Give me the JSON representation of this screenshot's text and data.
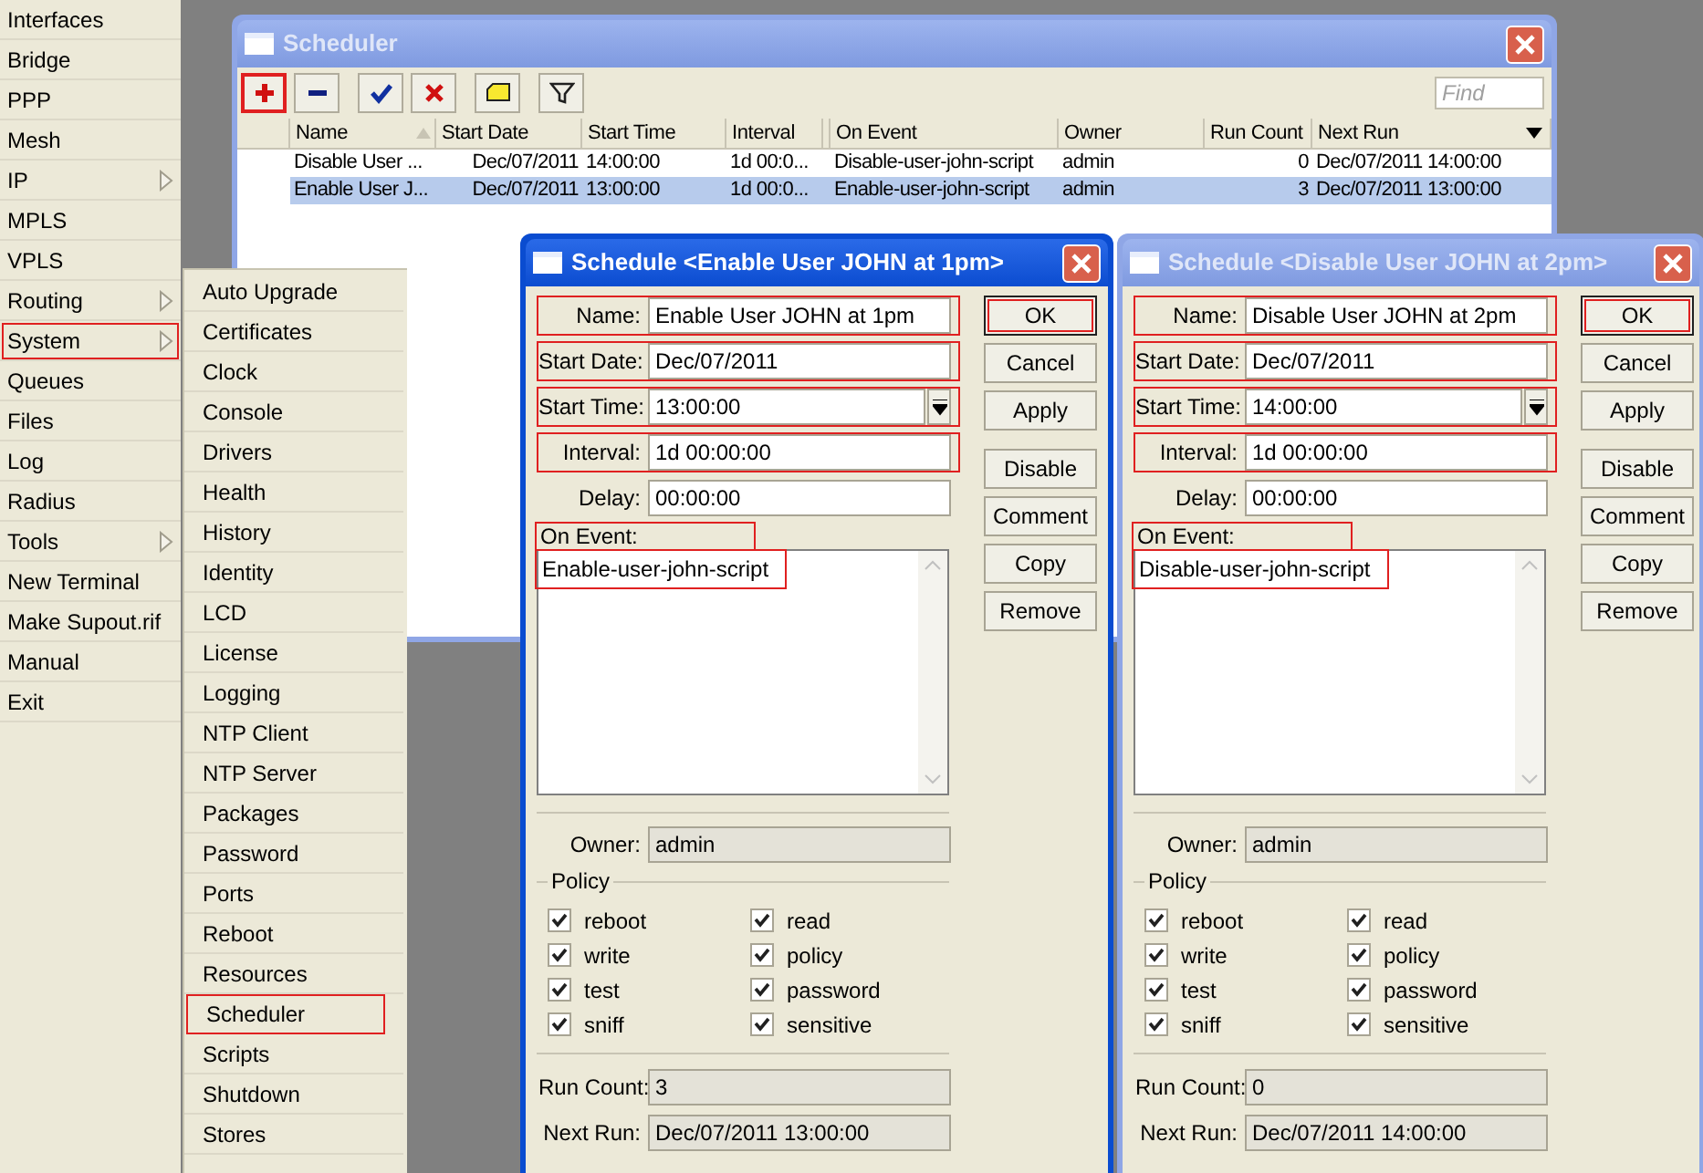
{
  "main_menu": {
    "items": [
      {
        "label": "Interfaces",
        "has_submenu": false,
        "highlighted": false
      },
      {
        "label": "Bridge",
        "has_submenu": false,
        "highlighted": false
      },
      {
        "label": "PPP",
        "has_submenu": false,
        "highlighted": false
      },
      {
        "label": "Mesh",
        "has_submenu": false,
        "highlighted": false
      },
      {
        "label": "IP",
        "has_submenu": true,
        "highlighted": false
      },
      {
        "label": "MPLS",
        "has_submenu": false,
        "highlighted": false
      },
      {
        "label": "VPLS",
        "has_submenu": false,
        "highlighted": false
      },
      {
        "label": "Routing",
        "has_submenu": true,
        "highlighted": false
      },
      {
        "label": "System",
        "has_submenu": true,
        "highlighted": true
      },
      {
        "label": "Queues",
        "has_submenu": false,
        "highlighted": false
      },
      {
        "label": "Files",
        "has_submenu": false,
        "highlighted": false
      },
      {
        "label": "Log",
        "has_submenu": false,
        "highlighted": false
      },
      {
        "label": "Radius",
        "has_submenu": false,
        "highlighted": false
      },
      {
        "label": "Tools",
        "has_submenu": true,
        "highlighted": false
      },
      {
        "label": "New Terminal",
        "has_submenu": false,
        "highlighted": false
      },
      {
        "label": "Make Supout.rif",
        "has_submenu": false,
        "highlighted": false
      },
      {
        "label": "Manual",
        "has_submenu": false,
        "highlighted": false
      },
      {
        "label": "Exit",
        "has_submenu": false,
        "highlighted": false
      }
    ]
  },
  "submenu": {
    "items": [
      {
        "label": "Auto Upgrade",
        "highlighted": false
      },
      {
        "label": "Certificates",
        "highlighted": false
      },
      {
        "label": "Clock",
        "highlighted": false
      },
      {
        "label": "Console",
        "highlighted": false
      },
      {
        "label": "Drivers",
        "highlighted": false
      },
      {
        "label": "Health",
        "highlighted": false
      },
      {
        "label": "History",
        "highlighted": false
      },
      {
        "label": "Identity",
        "highlighted": false
      },
      {
        "label": "LCD",
        "highlighted": false
      },
      {
        "label": "License",
        "highlighted": false
      },
      {
        "label": "Logging",
        "highlighted": false
      },
      {
        "label": "NTP Client",
        "highlighted": false
      },
      {
        "label": "NTP Server",
        "highlighted": false
      },
      {
        "label": "Packages",
        "highlighted": false
      },
      {
        "label": "Password",
        "highlighted": false
      },
      {
        "label": "Ports",
        "highlighted": false
      },
      {
        "label": "Reboot",
        "highlighted": false
      },
      {
        "label": "Resources",
        "highlighted": false
      },
      {
        "label": "Scheduler",
        "highlighted": true
      },
      {
        "label": "Scripts",
        "highlighted": false
      },
      {
        "label": "Shutdown",
        "highlighted": false
      },
      {
        "label": "Stores",
        "highlighted": false
      }
    ]
  },
  "scheduler": {
    "title": "Scheduler",
    "active": false,
    "toolbar": [
      {
        "kind": "add",
        "highlighted": true
      },
      {
        "kind": "remove",
        "highlighted": false
      },
      {
        "kind": "enable",
        "highlighted": false
      },
      {
        "kind": "disable",
        "highlighted": false
      },
      {
        "kind": "comment",
        "highlighted": false
      },
      {
        "kind": "filter",
        "highlighted": false
      }
    ],
    "find_placeholder": "Find",
    "columns": [
      {
        "label": "Name",
        "sorted": true
      },
      {
        "label": "Start Date",
        "sorted": false
      },
      {
        "label": "Start Time",
        "sorted": false
      },
      {
        "label": "Interval",
        "sorted": false
      },
      {
        "label": "On Event",
        "sorted": false
      },
      {
        "label": "Owner",
        "sorted": false
      },
      {
        "label": "Run Count",
        "sorted": false
      },
      {
        "label": "Next Run",
        "sorted": false
      }
    ],
    "rows": [
      {
        "selected": false,
        "cells": [
          "Disable User ...",
          "Dec/07/2011",
          "14:00:00",
          "1d 00:0...",
          "Disable-user-john-script",
          "admin",
          "0",
          "Dec/07/2011 14:00:00"
        ]
      },
      {
        "selected": true,
        "cells": [
          "Enable User J...",
          "Dec/07/2011",
          "13:00:00",
          "1d 00:0...",
          "Enable-user-john-script",
          "admin",
          "3",
          "Dec/07/2011 13:00:00"
        ]
      }
    ]
  },
  "dialogs": [
    {
      "title": "Schedule <Enable User JOHN at 1pm>",
      "active": true,
      "fields": [
        {
          "kind": "text",
          "label": "Name:",
          "value": "Enable User JOHN at 1pm",
          "highlighted": true
        },
        {
          "kind": "text",
          "label": "Start Date:",
          "value": "Dec/07/2011",
          "highlighted": true
        },
        {
          "kind": "dropdown",
          "label": "Start Time:",
          "value": "13:00:00",
          "highlighted": true
        },
        {
          "kind": "text",
          "label": "Interval:",
          "value": "1d 00:00:00",
          "highlighted": true
        },
        {
          "kind": "text",
          "label": "Delay:",
          "value": "00:00:00",
          "highlighted": false
        }
      ],
      "on_event": {
        "label": "On Event:",
        "value": "Enable-user-john-script",
        "highlighted": true
      },
      "owner": {
        "label": "Owner:",
        "value": "admin"
      },
      "policy": {
        "label": "Policy",
        "options": [
          {
            "label": "reboot",
            "checked": true
          },
          {
            "label": "read",
            "checked": true
          },
          {
            "label": "write",
            "checked": true
          },
          {
            "label": "policy",
            "checked": true
          },
          {
            "label": "test",
            "checked": true
          },
          {
            "label": "password",
            "checked": true
          },
          {
            "label": "sniff",
            "checked": true
          },
          {
            "label": "sensitive",
            "checked": true
          }
        ]
      },
      "run_count": {
        "label": "Run Count:",
        "value": "3"
      },
      "next_run": {
        "label": "Next Run:",
        "value": "Dec/07/2011 13:00:00"
      },
      "buttons": [
        {
          "label": "OK",
          "highlighted": true
        },
        {
          "label": "Cancel",
          "highlighted": false
        },
        {
          "label": "Apply",
          "highlighted": false
        },
        {
          "label": "Disable",
          "highlighted": false
        },
        {
          "label": "Comment",
          "highlighted": false
        },
        {
          "label": "Copy",
          "highlighted": false
        },
        {
          "label": "Remove",
          "highlighted": false
        }
      ]
    },
    {
      "title": "Schedule <Disable User JOHN at 2pm>",
      "active": false,
      "fields": [
        {
          "kind": "text",
          "label": "Name:",
          "value": "Disable User JOHN at 2pm",
          "highlighted": true
        },
        {
          "kind": "text",
          "label": "Start Date:",
          "value": "Dec/07/2011",
          "highlighted": true
        },
        {
          "kind": "dropdown",
          "label": "Start Time:",
          "value": "14:00:00",
          "highlighted": true
        },
        {
          "kind": "text",
          "label": "Interval:",
          "value": "1d 00:00:00",
          "highlighted": true
        },
        {
          "kind": "text",
          "label": "Delay:",
          "value": "00:00:00",
          "highlighted": false
        }
      ],
      "on_event": {
        "label": "On Event:",
        "value": "Disable-user-john-script",
        "highlighted": true
      },
      "owner": {
        "label": "Owner:",
        "value": "admin"
      },
      "policy": {
        "label": "Policy",
        "options": [
          {
            "label": "reboot",
            "checked": true
          },
          {
            "label": "read",
            "checked": true
          },
          {
            "label": "write",
            "checked": true
          },
          {
            "label": "policy",
            "checked": true
          },
          {
            "label": "test",
            "checked": true
          },
          {
            "label": "password",
            "checked": true
          },
          {
            "label": "sniff",
            "checked": true
          },
          {
            "label": "sensitive",
            "checked": true
          }
        ]
      },
      "run_count": {
        "label": "Run Count:",
        "value": "0"
      },
      "next_run": {
        "label": "Next Run:",
        "value": "Dec/07/2011 14:00:00"
      },
      "buttons": [
        {
          "label": "OK",
          "highlighted": true
        },
        {
          "label": "Cancel",
          "highlighted": false
        },
        {
          "label": "Apply",
          "highlighted": false
        },
        {
          "label": "Disable",
          "highlighted": false
        },
        {
          "label": "Comment",
          "highlighted": false
        },
        {
          "label": "Copy",
          "highlighted": false
        },
        {
          "label": "Remove",
          "highlighted": false
        }
      ]
    }
  ]
}
